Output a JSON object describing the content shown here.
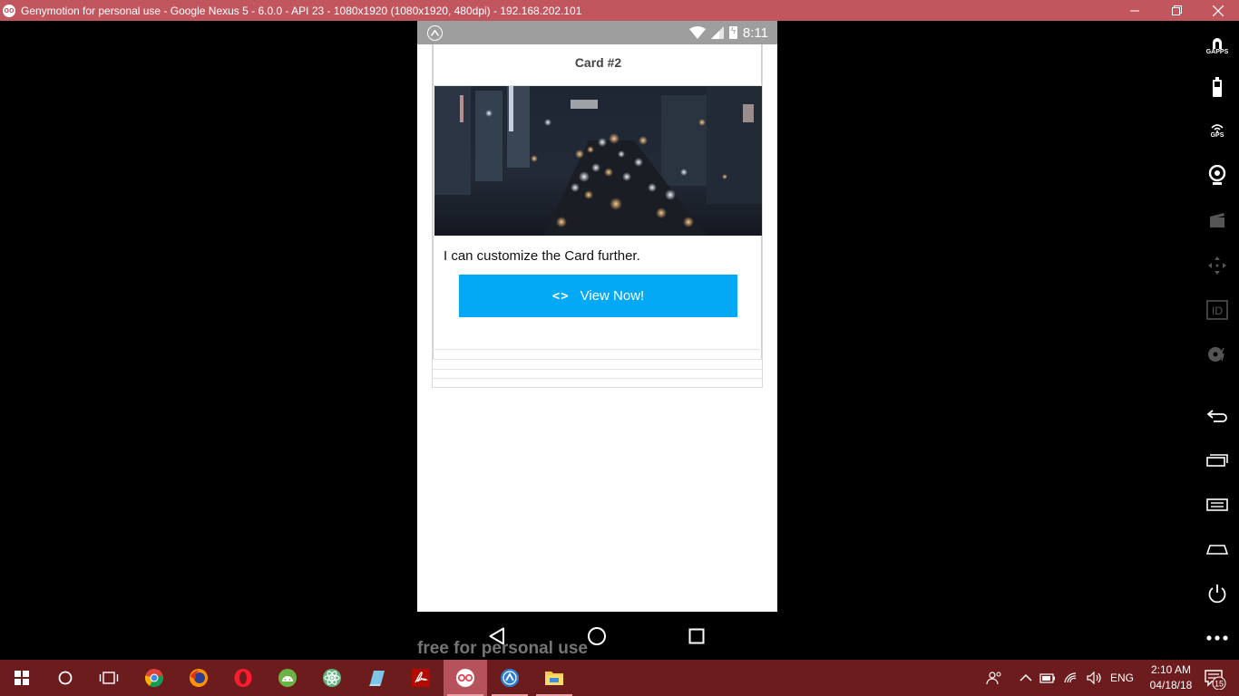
{
  "window": {
    "title": "Genymotion for personal use - Google Nexus 5 - 6.0.0 - API 23 - 1080x1920 (1080x1920, 480dpi) - 192.168.202.101",
    "logo_text": "oo"
  },
  "statusbar": {
    "time": "8:11"
  },
  "card": {
    "title": "Card #2",
    "text": "I can customize the Card further.",
    "button_icon": "<>",
    "button_label": "View Now!"
  },
  "watermark": "free for personal use",
  "sidebar": {
    "gapps_label": "GAPPS",
    "gps_label": "GPS",
    "id_label": "ID"
  },
  "taskbar": {
    "language": "ENG",
    "time": "2:10 AM",
    "date": "04/18/18",
    "notification_count": "15"
  },
  "colors": {
    "titlebar": "#c1565f",
    "taskbar": "#6d1c1e",
    "button": "#03a9f4",
    "statusbar": "#9e9e9e"
  }
}
